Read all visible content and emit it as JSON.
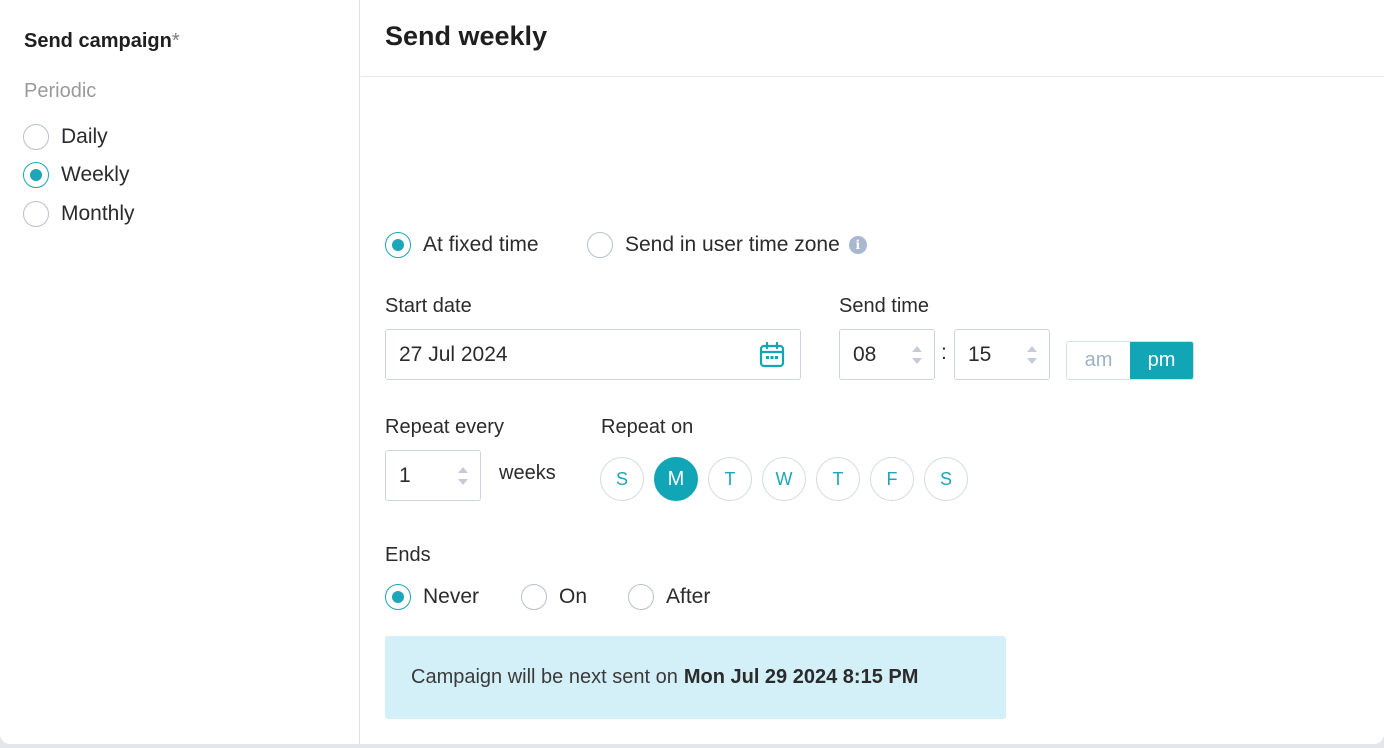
{
  "sidebar": {
    "title": "Send campaign",
    "required_mark": "*",
    "group_label": "Periodic",
    "options": [
      {
        "label": "Daily",
        "selected": false
      },
      {
        "label": "Weekly",
        "selected": true
      },
      {
        "label": "Monthly",
        "selected": false
      }
    ]
  },
  "main": {
    "title": "Send weekly",
    "timing": {
      "fixed_label": "At fixed time",
      "fixed_selected": true,
      "zone_label": "Send in user time zone",
      "zone_selected": false,
      "info_icon": "info-icon"
    },
    "start_date": {
      "label": "Start date",
      "value": "27 Jul 2024",
      "icon": "calendar-icon"
    },
    "send_time": {
      "label": "Send time",
      "hour": "08",
      "separator": ":",
      "minute": "15",
      "am_label": "am",
      "pm_label": "pm",
      "selected_period": "pm"
    },
    "repeat_every": {
      "label": "Repeat every",
      "value": "1",
      "unit": "weeks"
    },
    "repeat_on": {
      "label": "Repeat on",
      "days": [
        {
          "label": "S",
          "selected": false
        },
        {
          "label": "M",
          "selected": true
        },
        {
          "label": "T",
          "selected": false
        },
        {
          "label": "W",
          "selected": false
        },
        {
          "label": "T",
          "selected": false
        },
        {
          "label": "F",
          "selected": false
        },
        {
          "label": "S",
          "selected": false
        }
      ]
    },
    "ends": {
      "label": "Ends",
      "options": [
        {
          "label": "Never",
          "selected": true
        },
        {
          "label": "On",
          "selected": false
        },
        {
          "label": "After",
          "selected": false
        }
      ]
    },
    "notice": {
      "prefix": "Campaign will be next sent on",
      "datetime": "Mon Jul 29 2024 8:15 PM"
    }
  },
  "colors": {
    "accent": "#11a5b5",
    "notice_bg": "#d3f0f8",
    "radio_border": "#b8c0ce"
  }
}
